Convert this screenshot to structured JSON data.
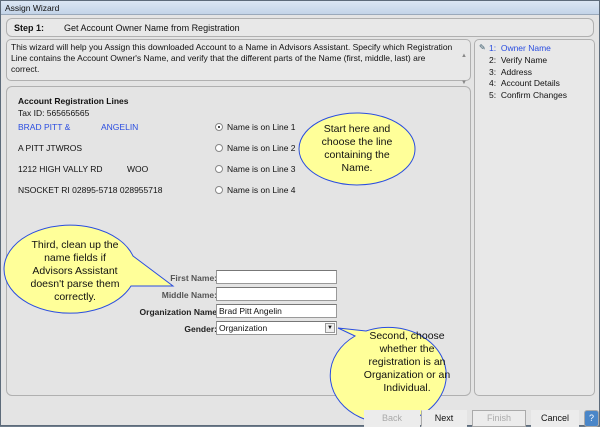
{
  "window": {
    "title": "Assign Wizard"
  },
  "step": {
    "label": "Step 1:",
    "title": "Get Account Owner Name from Registration"
  },
  "description": "This wizard will help you Assign this downloaded Account to a Name in Advisors Assistant.  Specify which Registration Line contains the Account Owner's Name, and verify that the different parts of the Name (first, middle, last) are correct.",
  "steps": [
    {
      "num": "1:",
      "label": "Owner Name",
      "current": true
    },
    {
      "num": "2:",
      "label": "Verify Name"
    },
    {
      "num": "3:",
      "label": "Address"
    },
    {
      "num": "4:",
      "label": "Account Details"
    },
    {
      "num": "5:",
      "label": "Confirm Changes"
    }
  ],
  "registration": {
    "heading": "Account Registration Lines",
    "tax_id": "Tax ID: 565656565",
    "lines": [
      {
        "a": "BRAD PITT &",
        "b": "ANGELIN",
        "radio": "Name is on Line 1",
        "selected": true
      },
      {
        "a": "A PITT  JTWROS",
        "b": "",
        "radio": "Name is on Line 2",
        "selected": false
      },
      {
        "a": "1212 HIGH VALLY RD",
        "b": "WOO",
        "radio": "Name is on Line 3",
        "selected": false
      },
      {
        "a": "NSOCKET RI  02895-5718 028955718",
        "b": "",
        "radio": "Name is on Line 4",
        "selected": false
      }
    ]
  },
  "form": {
    "first_name_label": "First Name:",
    "first_name": "",
    "middle_name_label": "Middle Name:",
    "middle_name": "",
    "org_label": "Organization Name",
    "org_name": "Brad Pitt Angelin",
    "gender_label": "Gender:",
    "gender": "Organization"
  },
  "callouts": {
    "start": "Start here and choose the line containing the Name.",
    "third": "Third, clean up the name fields if Advisors Assistant doesn't parse them correctly.",
    "second": "Second, choose whether the registration is an Organization or an Individual.",
    "fill": "#ffff99",
    "stroke": "#2a4de0"
  },
  "buttons": {
    "back": "Back",
    "next": "Next",
    "finish": "Finish",
    "cancel": "Cancel"
  },
  "colors": {
    "accent": "#2a4de0"
  }
}
